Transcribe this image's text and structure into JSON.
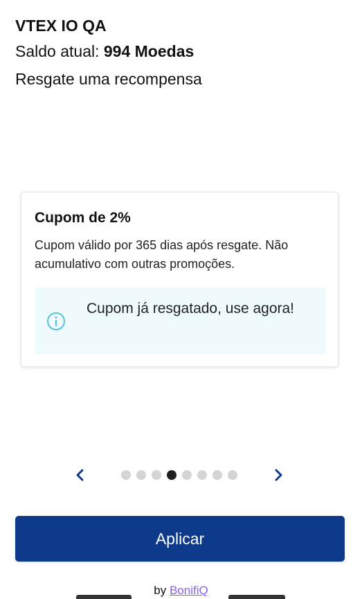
{
  "header": {
    "store_name": "VTEX IO QA",
    "balance_label": "Saldo atual: ",
    "balance_value": "994 Moedas",
    "subtitle": "Resgate uma recompensa"
  },
  "reward_card": {
    "title": "Cupom de 2%",
    "description": "Cupom válido por 365 dias após resgate. Não acumulativo com outras promoções.",
    "alert_text": "Cupom já resgatado, use agora!",
    "alert_icon": "info-icon"
  },
  "carousel": {
    "prev_icon": "chevron-left-icon",
    "next_icon": "chevron-right-icon",
    "total_slides": 8,
    "active_index": 3
  },
  "actions": {
    "apply_label": "Aplicar"
  },
  "footer": {
    "by_label": "by ",
    "brand": "BonifiQ"
  },
  "colors": {
    "primary": "#0e3a8c",
    "nav_arrow": "#0e3a8c",
    "alert_bg": "#effafc",
    "alert_icon": "#5bc0de",
    "brand_link": "#8b5cf6",
    "dot_active": "#1f1f1f",
    "dot_inactive": "#d4d4d4"
  }
}
